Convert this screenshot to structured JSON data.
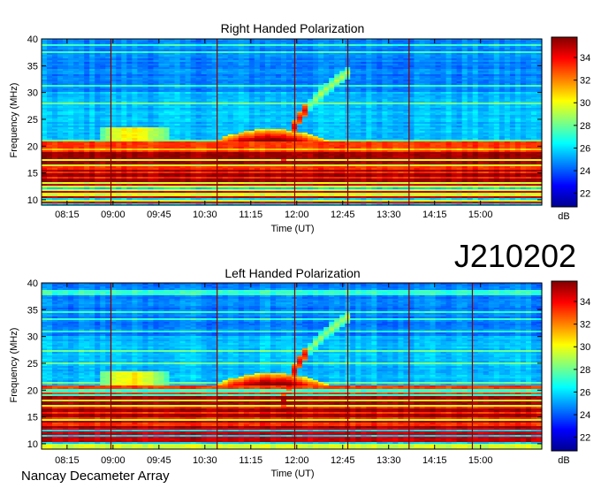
{
  "figure": {
    "observation_id": "J210202",
    "credit": "Nancay Decameter Array"
  },
  "chart_data": [
    {
      "type": "heatmap",
      "title": "Right Handed Polarization",
      "xlabel": "Time (UT)",
      "ylabel": "Frequency (MHz)",
      "x_ticks": [
        "08:15",
        "09:00",
        "09:45",
        "10:30",
        "11:15",
        "12:00",
        "12:45",
        "13:30",
        "14:15",
        "15:00"
      ],
      "xlim": [
        "07:50",
        "16:00"
      ],
      "y_ticks": [
        10,
        15,
        20,
        25,
        30,
        35,
        40
      ],
      "ylim": [
        9,
        40
      ],
      "colorbar": {
        "label": "dB",
        "ticks": [
          22,
          24,
          26,
          28,
          30,
          32,
          34
        ],
        "range": [
          20.8,
          35.8
        ],
        "colormap": "jet"
      },
      "features": {
        "intense_band_mhz": [
          13,
          21
        ],
        "burst_peak_time": "11:35",
        "burst_peak_mhz": 23,
        "arc_start": [
          "11:50",
          18
        ],
        "arc_end": [
          "12:45",
          33
        ],
        "vertical_lines": [
          "08:58",
          "10:42",
          "11:58",
          "12:50",
          "13:50"
        ]
      }
    },
    {
      "type": "heatmap",
      "title": "Left Handed Polarization",
      "xlabel": "Time (UT)",
      "ylabel": "Frequency (MHz)",
      "x_ticks": [
        "08:15",
        "09:00",
        "09:45",
        "10:30",
        "11:15",
        "12:00",
        "12:45",
        "13:30",
        "14:15",
        "15:00"
      ],
      "xlim": [
        "07:50",
        "16:00"
      ],
      "y_ticks": [
        10,
        15,
        20,
        25,
        30,
        35,
        40
      ],
      "ylim": [
        9,
        40
      ],
      "colorbar": {
        "label": "dB",
        "ticks": [
          22,
          24,
          26,
          28,
          30,
          32,
          34
        ],
        "range": [
          20.8,
          35.8
        ],
        "colormap": "jet"
      },
      "features": {
        "intense_band_mhz": [
          13,
          21
        ],
        "burst_peak_time": "11:35",
        "burst_peak_mhz": 23,
        "arc_start": [
          "11:50",
          18
        ],
        "arc_end": [
          "12:45",
          33
        ],
        "vertical_lines": [
          "08:58",
          "10:42",
          "11:58",
          "12:50",
          "13:50",
          "14:52"
        ]
      }
    }
  ]
}
